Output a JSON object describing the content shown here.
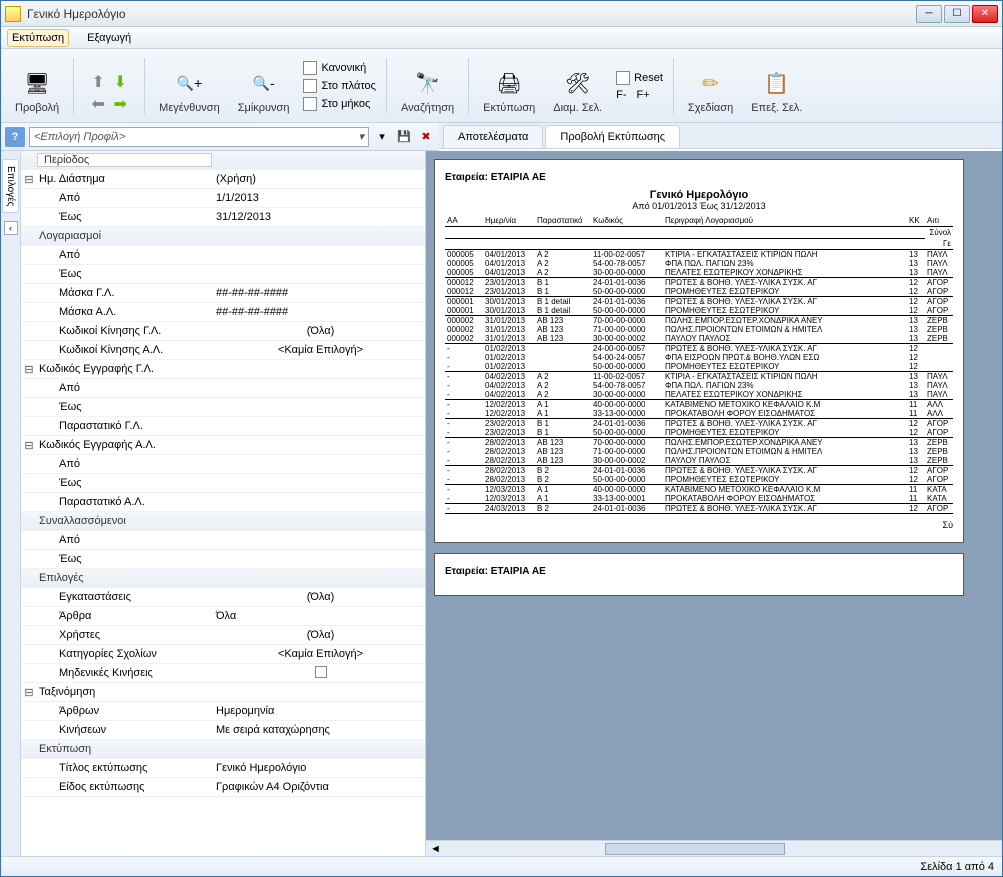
{
  "window": {
    "title": "Γενικό Ημερολόγιο"
  },
  "menu": {
    "print": "Εκτύπωση",
    "export": "Εξαγωγή"
  },
  "toolbar": {
    "preview": "Προβολή",
    "zoomin": "Μεγένθυνση",
    "zoomout": "Σμίκρυνση",
    "normal": "Κανονική",
    "width": "Στο πλάτος",
    "height": "Στο μήκος",
    "search": "Αναζήτηση",
    "print": "Εκτύπωση",
    "pagesetup": "Διαμ. Σελ.",
    "reset": "Reset",
    "fminus": "F-",
    "fplus": "F+",
    "design": "Σχεδίαση",
    "editpage": "Επεξ. Σελ."
  },
  "profile": {
    "placeholder": "<Επιλογή Προφίλ>"
  },
  "sidetab": {
    "employees": "Επιλογές"
  },
  "grid": {
    "header": "Περίοδος",
    "range_label": "Ημ. Διάστημα",
    "range_value": "(Χρήση)",
    "from_label": "Από",
    "from_value": "1/1/2013",
    "to_label": "Έως",
    "to_value": "31/12/2013",
    "accounts": "Λογαριασμοί",
    "acc_from": "Από",
    "acc_to": "Έως",
    "mask_gl_label": "Μάσκα Γ.Λ.",
    "mask_gl_value": "##-##-##-####",
    "mask_al_label": "Μάσκα Α.Λ.",
    "mask_al_value": "##-##-##-####",
    "mov_gl_label": "Κωδικοί Κίνησης Γ.Λ.",
    "mov_gl_value": "(Όλα)",
    "mov_al_label": "Κωδικοί Κίνησης Α.Λ.",
    "mov_al_value": "<Καμία Επιλογή>",
    "entry_gl": "Κωδικός Εγγραφής Γ.Λ.",
    "egl_from": "Από",
    "egl_to": "Έως",
    "egl_doc": "Παραστατικό Γ.Λ.",
    "entry_al": "Κωδικός Εγγραφής Α.Λ.",
    "eal_from": "Από",
    "eal_to": "Έως",
    "eal_doc": "Παραστατικό Α.Λ.",
    "partners": "Συναλλασσόμενοι",
    "p_from": "Από",
    "p_to": "Έως",
    "options": "Επιλογές",
    "install_label": "Εγκαταστάσεις",
    "install_value": "(Όλα)",
    "articles_label": "Άρθρα",
    "articles_value": "Όλα",
    "users_label": "Χρήστες",
    "users_value": "(Όλα)",
    "commcat_label": "Κατηγορίες Σχολίων",
    "commcat_value": "<Καμία Επιλογή>",
    "zero_label": "Μηδενικές Κινήσεις",
    "sort": "Ταξινόμηση",
    "sort_art_label": "Άρθρων",
    "sort_art_value": "Ημερομηνία",
    "sort_mov_label": "Κινήσεων",
    "sort_mov_value": "Με σειρά καταχώρησης",
    "printing": "Εκτύπωση",
    "ptitle_label": "Τίτλος εκτύπωσης",
    "ptitle_value": "Γενικό Ημερολόγιο",
    "ptype_label": "Είδος εκτύπωσης",
    "ptype_value": "Γραφικών Α4 Οριζόντια"
  },
  "tabs": {
    "results": "Αποτελέσματα",
    "print_preview": "Προβολή Εκτύπωσης"
  },
  "report": {
    "company": "Εταιρεία: ΕΤΑΙΡΙΑ ΑΕ",
    "title": "Γενικό Ημερολόγιο",
    "range": "Από 01/01/2013 Έως 31/12/2013",
    "headers": {
      "aa": "ΑΑ",
      "date": "Ημερ/νία",
      "doc": "Παραστατικό",
      "code": "Κωδικός",
      "desc": "Περιγραφή Λογαριασμού",
      "kk": "ΚΚ",
      "ait": "Αιτι"
    },
    "subhead1": "Σύνολ",
    "subhead2": "Γε",
    "rows": [
      {
        "aa": "000005",
        "date": "04/01/2013",
        "doc": "Α 2",
        "code": "11-00-02-0057",
        "desc": "ΚΤΙΡΙΑ - ΕΓΚΑΤΑΣΤΑΣΕΙΣ ΚΤΙΡΙΩΝ ΠΩΛΗ",
        "kk": "13",
        "ait": "ΠΑΥΛ",
        "grp": true
      },
      {
        "aa": "000005",
        "date": "04/01/2013",
        "doc": "Α 2",
        "code": "54-00-78-0057",
        "desc": "ΦΠΑ ΠΩΛ. ΠΑΓΙΩΝ 23%",
        "kk": "13",
        "ait": "ΠΑΥΛ"
      },
      {
        "aa": "000005",
        "date": "04/01/2013",
        "doc": "Α 2",
        "code": "30-00-00-0000",
        "desc": "ΠΕΛΑΤΕΣ ΕΣΩΤΕΡΙΚΟΥ ΧΟΝΔΡΙΚΗΣ",
        "kk": "13",
        "ait": "ΠΑΥΛ",
        "last": true
      },
      {
        "aa": "000012",
        "date": "23/01/2013",
        "doc": "Β 1",
        "code": "24-01-01-0036",
        "desc": "ΠΡΩΤΕΣ & ΒΟΗΘ. ΥΛΕΣ-ΥΛΙΚΑ ΣΥΣΚ. ΑΓ",
        "kk": "12",
        "ait": "ΑΓΟΡ",
        "grp": true
      },
      {
        "aa": "000012",
        "date": "23/01/2013",
        "doc": "Β 1",
        "code": "50-00-00-0000",
        "desc": "ΠΡΟΜΗΘΕΥΤΕΣ ΕΣΩΤΕΡΙΚΟΥ",
        "kk": "12",
        "ait": "ΑΓΟΡ",
        "last": true
      },
      {
        "aa": "000001",
        "date": "30/01/2013",
        "doc": "Β 1 detail",
        "code": "24-01-01-0036",
        "desc": "ΠΡΩΤΕΣ & ΒΟΗΘ. ΥΛΕΣ-ΥΛΙΚΑ ΣΥΣΚ. ΑΓ",
        "kk": "12",
        "ait": "ΑΓΟΡ",
        "grp": true
      },
      {
        "aa": "000001",
        "date": "30/01/2013",
        "doc": "Β 1 detail",
        "code": "50-00-00-0000",
        "desc": "ΠΡΟΜΗΘΕΥΤΕΣ ΕΣΩΤΕΡΙΚΟΥ",
        "kk": "12",
        "ait": "ΑΓΟΡ",
        "last": true
      },
      {
        "aa": "000002",
        "date": "31/01/2013",
        "doc": "ΑΒ 123",
        "code": "70-00-00-0000",
        "desc": "ΠΩΛΗΣ.ΕΜΠΟΡ.ΕΣΩΤΕΡ.ΧΟΝΔΡΙΚΑ ΑΝΕΥ",
        "kk": "13",
        "ait": "ΖΕΡΒ",
        "grp": true
      },
      {
        "aa": "000002",
        "date": "31/01/2013",
        "doc": "ΑΒ 123",
        "code": "71-00-00-0000",
        "desc": "ΠΩΛΗΣ.ΠΡΟΙΟΝΤΩΝ ΕΤΟΙΜΩΝ & ΗΜΙΤΕΛ",
        "kk": "13",
        "ait": "ΖΕΡΒ"
      },
      {
        "aa": "000002",
        "date": "31/01/2013",
        "doc": "ΑΒ 123",
        "code": "30-00-00-0002",
        "desc": "ΠΑΥΛΟΥ ΠΑΥΛΟΣ",
        "kk": "13",
        "ait": "ΖΕΡΒ",
        "last": true
      },
      {
        "aa": "-",
        "date": "01/02/2013",
        "doc": "",
        "code": "24-00-00-0057",
        "desc": "ΠΡΩΤΕΣ & ΒΟΗΘ. ΥΛΕΣ-ΥΛΙΚΑ ΣΥΣΚ. ΑΓ",
        "kk": "12",
        "ait": "",
        "grp": true
      },
      {
        "aa": "-",
        "date": "01/02/2013",
        "doc": "",
        "code": "54-00-24-0057",
        "desc": "ΦΠΑ ΕΙΣΡΟΩΝ ΠΡΩΤ.& ΒΟΗΘ.ΥΛΩΝ ΕΣΩ",
        "kk": "12",
        "ait": ""
      },
      {
        "aa": "-",
        "date": "01/02/2013",
        "doc": "",
        "code": "50-00-00-0000",
        "desc": "ΠΡΟΜΗΘΕΥΤΕΣ ΕΣΩΤΕΡΙΚΟΥ",
        "kk": "12",
        "ait": "",
        "last": true
      },
      {
        "aa": "-",
        "date": "04/02/2013",
        "doc": "Α 2",
        "code": "11-00-02-0057",
        "desc": "ΚΤΙΡΙΑ - ΕΓΚΑΤΑΣΤΑΣΕΙΣ ΚΤΙΡΙΩΝ ΠΩΛΗ",
        "kk": "13",
        "ait": "ΠΑΥΛ",
        "grp": true
      },
      {
        "aa": "-",
        "date": "04/02/2013",
        "doc": "Α 2",
        "code": "54-00-78-0057",
        "desc": "ΦΠΑ ΠΩΛ. ΠΑΓΙΩΝ 23%",
        "kk": "13",
        "ait": "ΠΑΥΛ"
      },
      {
        "aa": "-",
        "date": "04/02/2013",
        "doc": "Α 2",
        "code": "30-00-00-0000",
        "desc": "ΠΕΛΑΤΕΣ ΕΣΩΤΕΡΙΚΟΥ ΧΟΝΔΡΙΚΗΣ",
        "kk": "13",
        "ait": "ΠΑΥΛ",
        "last": true
      },
      {
        "aa": "-",
        "date": "12/02/2013",
        "doc": "Α 1",
        "code": "40-00-00-0000",
        "desc": "ΚΑΤΑΒΙΜΕΝΟ ΜΕΤΟΧΙΚΟ ΚΕΦΑΛΑΙΟ Κ.Μ",
        "kk": "11",
        "ait": "ΑΛΛ",
        "grp": true
      },
      {
        "aa": "-",
        "date": "12/02/2013",
        "doc": "Α 1",
        "code": "33-13-00-0000",
        "desc": "ΠΡΟΚΑΤΑΒΟΛΗ ΦΟΡΟΥ ΕΙΣΟΔΗΜΑΤΟΣ",
        "kk": "11",
        "ait": "ΑΛΛ",
        "last": true
      },
      {
        "aa": "-",
        "date": "23/02/2013",
        "doc": "Β 1",
        "code": "24-01-01-0036",
        "desc": "ΠΡΩΤΕΣ & ΒΟΗΘ. ΥΛΕΣ-ΥΛΙΚΑ ΣΥΣΚ. ΑΓ",
        "kk": "12",
        "ait": "ΑΓΟΡ",
        "grp": true
      },
      {
        "aa": "-",
        "date": "23/02/2013",
        "doc": "Β 1",
        "code": "50-00-00-0000",
        "desc": "ΠΡΟΜΗΘΕΥΤΕΣ ΕΣΩΤΕΡΙΚΟΥ",
        "kk": "12",
        "ait": "ΑΓΟΡ",
        "last": true
      },
      {
        "aa": "-",
        "date": "28/02/2013",
        "doc": "ΑΒ 123",
        "code": "70-00-00-0000",
        "desc": "ΠΩΛΗΣ.ΕΜΠΟΡ.ΕΣΩΤΕΡ.ΧΟΝΔΡΙΚΑ ΑΝΕΥ",
        "kk": "13",
        "ait": "ΖΕΡΒ",
        "grp": true
      },
      {
        "aa": "-",
        "date": "28/02/2013",
        "doc": "ΑΒ 123",
        "code": "71-00-00-0000",
        "desc": "ΠΩΛΗΣ.ΠΡΟΙΟΝΤΩΝ ΕΤΟΙΜΩΝ & ΗΜΙΤΕΛ",
        "kk": "13",
        "ait": "ΖΕΡΒ"
      },
      {
        "aa": "-",
        "date": "28/02/2013",
        "doc": "ΑΒ 123",
        "code": "30-00-00-0002",
        "desc": "ΠΑΥΛΟΥ ΠΑΥΛΟΣ",
        "kk": "13",
        "ait": "ΖΕΡΒ",
        "last": true
      },
      {
        "aa": "-",
        "date": "28/02/2013",
        "doc": "Β 2",
        "code": "24-01-01-0036",
        "desc": "ΠΡΩΤΕΣ & ΒΟΗΘ. ΥΛΕΣ-ΥΛΙΚΑ ΣΥΣΚ. ΑΓ",
        "kk": "12",
        "ait": "ΑΓΟΡ",
        "grp": true
      },
      {
        "aa": "-",
        "date": "28/02/2013",
        "doc": "Β 2",
        "code": "50-00-00-0000",
        "desc": "ΠΡΟΜΗΘΕΥΤΕΣ ΕΣΩΤΕΡΙΚΟΥ",
        "kk": "12",
        "ait": "ΑΓΟΡ",
        "last": true
      },
      {
        "aa": "-",
        "date": "12/03/2013",
        "doc": "Α 1",
        "code": "40-00-00-0000",
        "desc": "ΚΑΤΑΒΙΜΕΝΟ ΜΕΤΟΧΙΚΟ ΚΕΦΑΛΑΙΟ Κ.Μ",
        "kk": "11",
        "ait": "ΚΑΤΑ",
        "grp": true
      },
      {
        "aa": "-",
        "date": "12/03/2013",
        "doc": "Α 1",
        "code": "33-13-00-0001",
        "desc": "ΠΡΟΚΑΤΑΒΟΛΗ ΦΟΡΟΥ ΕΙΣΟΔΗΜΑΤΟΣ",
        "kk": "11",
        "ait": "ΚΑΤΑ",
        "last": true
      },
      {
        "aa": "-",
        "date": "24/03/2013",
        "doc": "Β 2",
        "code": "24-01-01-0036",
        "desc": "ΠΡΩΤΕΣ & ΒΟΗΘ. ΥΛΕΣ-ΥΛΙΚΑ ΣΥΣΚ. ΑΓ",
        "kk": "12",
        "ait": "ΑΓΟΡ",
        "grp": true,
        "last": true
      }
    ],
    "footer": "Σύ"
  },
  "status": {
    "page": "Σελίδα 1 από 4"
  }
}
